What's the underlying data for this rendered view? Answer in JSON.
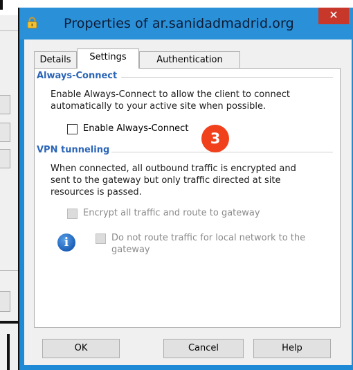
{
  "dialog": {
    "title": "Properties of ar.sanidadmadrid.org",
    "close_glyph": "✕",
    "lock_icon": "lock-icon"
  },
  "tabs": [
    {
      "label": "Details",
      "selected": false
    },
    {
      "label": "Settings",
      "selected": true
    },
    {
      "label": "Authentication",
      "selected": false
    }
  ],
  "always_connect": {
    "heading": "Always-Connect",
    "description_line1": "Enable Always-Connect to allow the client to connect",
    "description_line2": "automatically to your active site when possible.",
    "checkbox_label": "Enable Always-Connect",
    "checked": false
  },
  "vpn_tunneling": {
    "heading": "VPN tunneling",
    "description_line1": "When connected, all outbound traffic is encrypted and",
    "description_line2": "sent to the gateway but only traffic directed at site",
    "description_line3": "resources is passed.",
    "encrypt_label": "Encrypt all traffic and route to gateway",
    "local_route_line1": "Do not route traffic for local network to the",
    "local_route_line2": "gateway",
    "info_glyph": "i"
  },
  "annotation": {
    "step_number": "3"
  },
  "buttons": {
    "ok": "OK",
    "cancel": "Cancel",
    "help": "Help"
  },
  "colors": {
    "title_bar": "#2a90d8",
    "close_button": "#c7382b",
    "heading_blue": "#2b65b7",
    "badge": "#f0411c"
  }
}
